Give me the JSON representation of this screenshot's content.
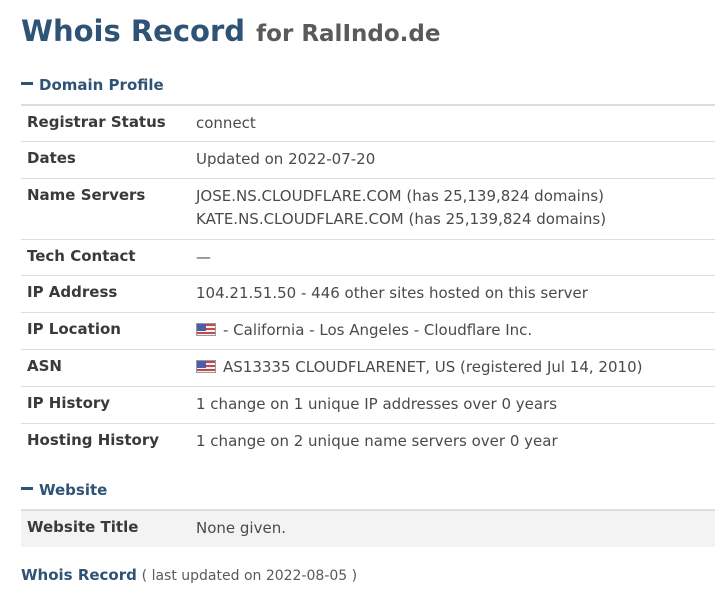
{
  "title": {
    "main": "Whois Record",
    "sub": "for RalIndo.de"
  },
  "sections": {
    "domain_profile": {
      "header": "Domain Profile",
      "rows": {
        "registrar_status": {
          "label": "Registrar Status",
          "value": "connect"
        },
        "dates": {
          "label": "Dates",
          "value": "Updated on 2022-07-20"
        },
        "name_servers": {
          "label": "Name Servers",
          "values": [
            "JOSE.NS.CLOUDFLARE.COM (has 25,139,824 domains)",
            "KATE.NS.CLOUDFLARE.COM (has 25,139,824 domains)"
          ]
        },
        "tech_contact": {
          "label": "Tech Contact",
          "value": "—"
        },
        "ip_address": {
          "label": "IP Address",
          "value": "104.21.51.50 - 446 other sites hosted on this server"
        },
        "ip_location": {
          "label": "IP Location",
          "value": "- California - Los Angeles - Cloudflare Inc.",
          "flag_icon": "us-flag-icon"
        },
        "asn": {
          "label": "ASN",
          "value": "AS13335 CLOUDFLARENET, US (registered Jul 14, 2010)",
          "flag_icon": "us-flag-icon"
        },
        "ip_history": {
          "label": "IP History",
          "value": "1 change on 1 unique IP addresses over 0 years"
        },
        "hosting_history": {
          "label": "Hosting History",
          "value": "1 change on 2 unique name servers over 0 year"
        }
      }
    },
    "website": {
      "header": "Website",
      "rows": {
        "website_title": {
          "label": "Website Title",
          "value": "None given."
        }
      }
    }
  },
  "footer": {
    "link": "Whois Record",
    "note": "( last updated on 2022-08-05 )"
  },
  "colors": {
    "heading_blue": "#2e5375",
    "row_divider": "#dddddd",
    "shaded_row": "#f3f3f3"
  }
}
